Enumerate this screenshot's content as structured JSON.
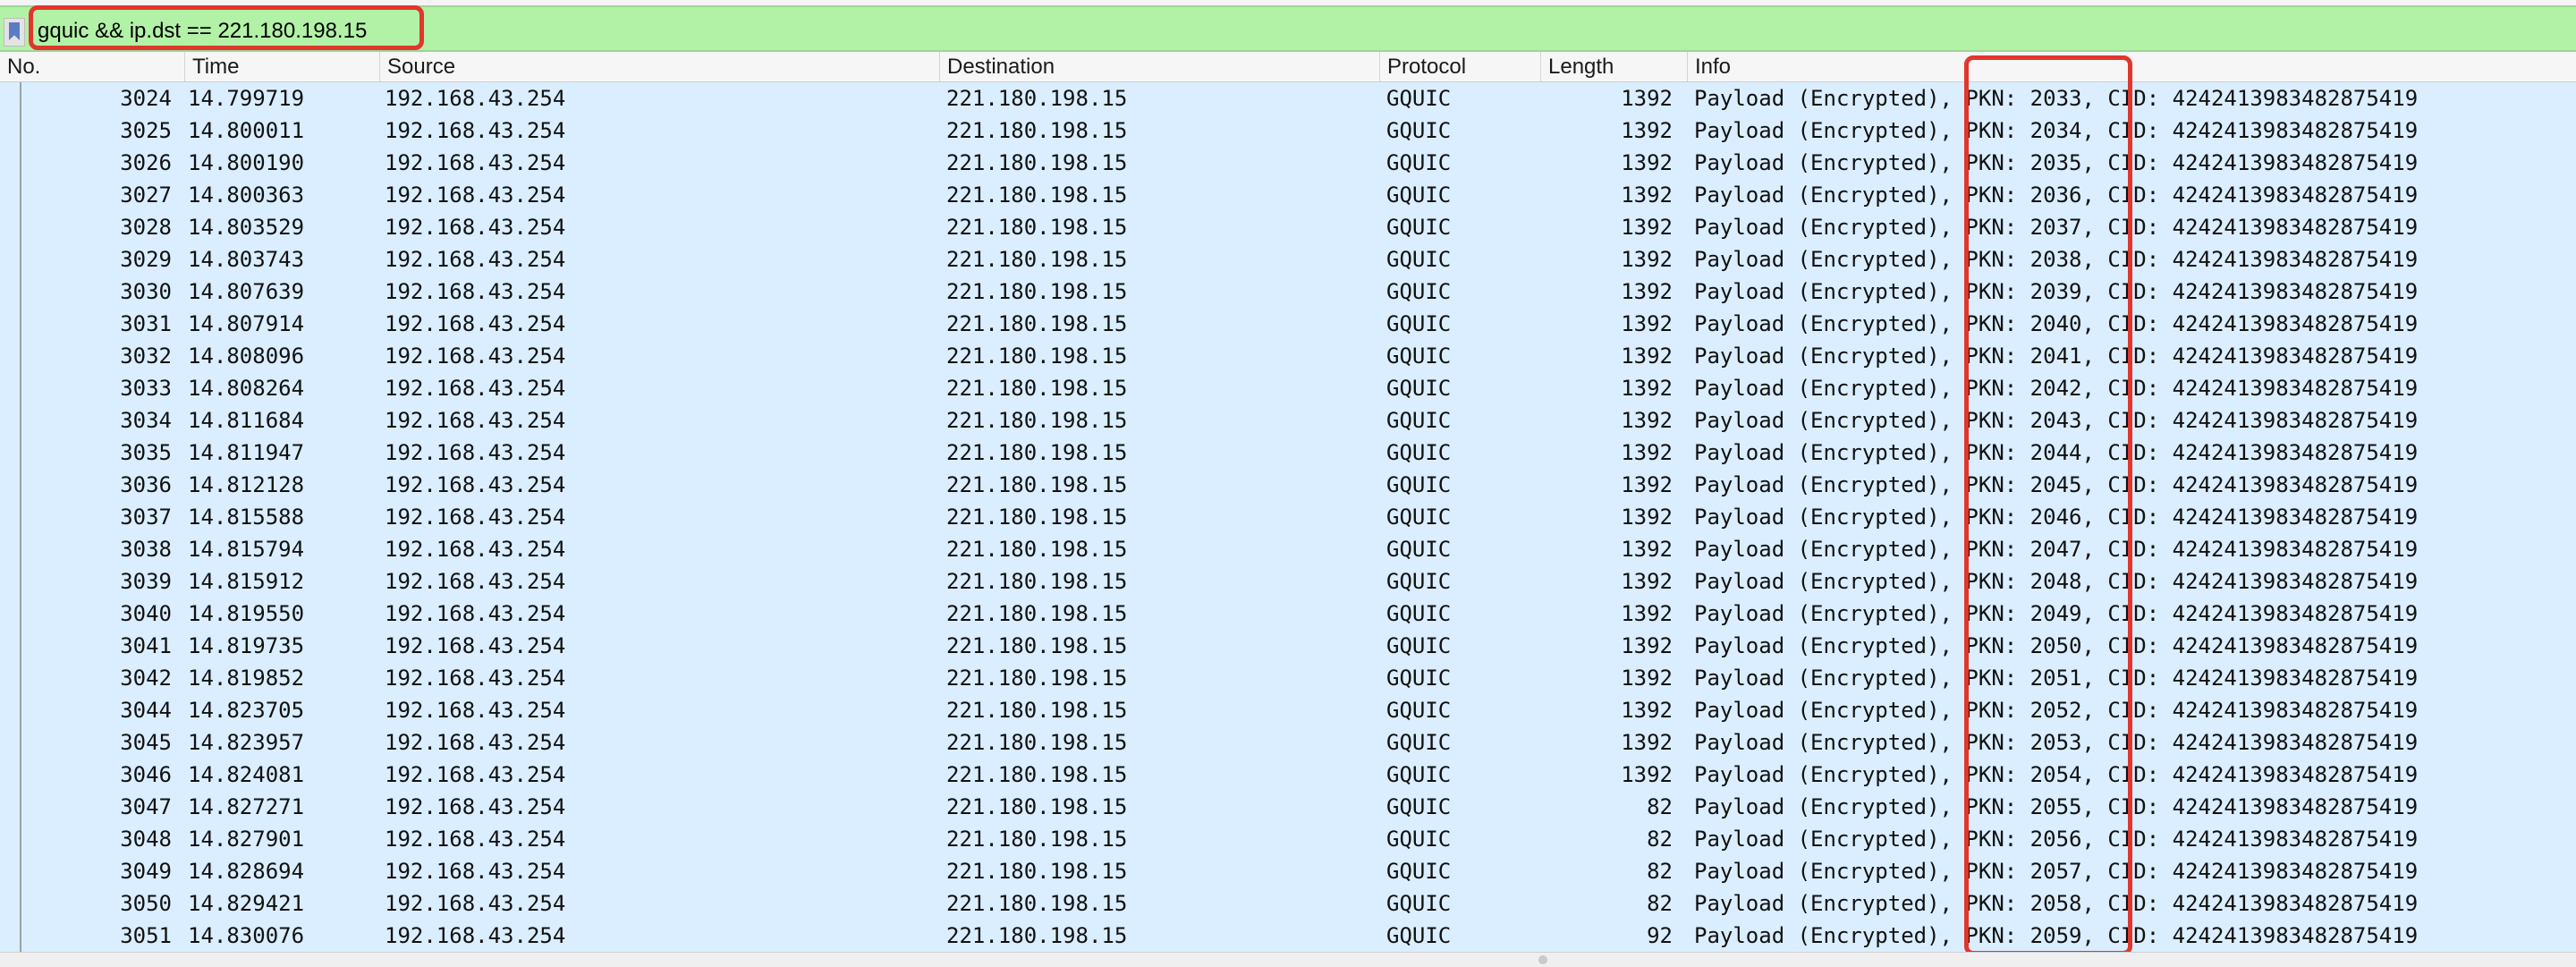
{
  "filter": {
    "value": "gquic && ip.dst == 221.180.198.15"
  },
  "columns": [
    "No.",
    "Time",
    "Source",
    "Destination",
    "Protocol",
    "Length",
    "Info"
  ],
  "packets": [
    {
      "no": "3024",
      "time": "14.799719",
      "src": "192.168.43.254",
      "dst": "221.180.198.15",
      "proto": "GQUIC",
      "len": "1392",
      "info": "Payload (Encrypted), PKN: 2033, CID: 4242413983482875419"
    },
    {
      "no": "3025",
      "time": "14.800011",
      "src": "192.168.43.254",
      "dst": "221.180.198.15",
      "proto": "GQUIC",
      "len": "1392",
      "info": "Payload (Encrypted), PKN: 2034, CID: 4242413983482875419"
    },
    {
      "no": "3026",
      "time": "14.800190",
      "src": "192.168.43.254",
      "dst": "221.180.198.15",
      "proto": "GQUIC",
      "len": "1392",
      "info": "Payload (Encrypted), PKN: 2035, CID: 4242413983482875419"
    },
    {
      "no": "3027",
      "time": "14.800363",
      "src": "192.168.43.254",
      "dst": "221.180.198.15",
      "proto": "GQUIC",
      "len": "1392",
      "info": "Payload (Encrypted), PKN: 2036, CID: 4242413983482875419"
    },
    {
      "no": "3028",
      "time": "14.803529",
      "src": "192.168.43.254",
      "dst": "221.180.198.15",
      "proto": "GQUIC",
      "len": "1392",
      "info": "Payload (Encrypted), PKN: 2037, CID: 4242413983482875419"
    },
    {
      "no": "3029",
      "time": "14.803743",
      "src": "192.168.43.254",
      "dst": "221.180.198.15",
      "proto": "GQUIC",
      "len": "1392",
      "info": "Payload (Encrypted), PKN: 2038, CID: 4242413983482875419"
    },
    {
      "no": "3030",
      "time": "14.807639",
      "src": "192.168.43.254",
      "dst": "221.180.198.15",
      "proto": "GQUIC",
      "len": "1392",
      "info": "Payload (Encrypted), PKN: 2039, CID: 4242413983482875419"
    },
    {
      "no": "3031",
      "time": "14.807914",
      "src": "192.168.43.254",
      "dst": "221.180.198.15",
      "proto": "GQUIC",
      "len": "1392",
      "info": "Payload (Encrypted), PKN: 2040, CID: 4242413983482875419"
    },
    {
      "no": "3032",
      "time": "14.808096",
      "src": "192.168.43.254",
      "dst": "221.180.198.15",
      "proto": "GQUIC",
      "len": "1392",
      "info": "Payload (Encrypted), PKN: 2041, CID: 4242413983482875419"
    },
    {
      "no": "3033",
      "time": "14.808264",
      "src": "192.168.43.254",
      "dst": "221.180.198.15",
      "proto": "GQUIC",
      "len": "1392",
      "info": "Payload (Encrypted), PKN: 2042, CID: 4242413983482875419"
    },
    {
      "no": "3034",
      "time": "14.811684",
      "src": "192.168.43.254",
      "dst": "221.180.198.15",
      "proto": "GQUIC",
      "len": "1392",
      "info": "Payload (Encrypted), PKN: 2043, CID: 4242413983482875419"
    },
    {
      "no": "3035",
      "time": "14.811947",
      "src": "192.168.43.254",
      "dst": "221.180.198.15",
      "proto": "GQUIC",
      "len": "1392",
      "info": "Payload (Encrypted), PKN: 2044, CID: 4242413983482875419"
    },
    {
      "no": "3036",
      "time": "14.812128",
      "src": "192.168.43.254",
      "dst": "221.180.198.15",
      "proto": "GQUIC",
      "len": "1392",
      "info": "Payload (Encrypted), PKN: 2045, CID: 4242413983482875419"
    },
    {
      "no": "3037",
      "time": "14.815588",
      "src": "192.168.43.254",
      "dst": "221.180.198.15",
      "proto": "GQUIC",
      "len": "1392",
      "info": "Payload (Encrypted), PKN: 2046, CID: 4242413983482875419"
    },
    {
      "no": "3038",
      "time": "14.815794",
      "src": "192.168.43.254",
      "dst": "221.180.198.15",
      "proto": "GQUIC",
      "len": "1392",
      "info": "Payload (Encrypted), PKN: 2047, CID: 4242413983482875419"
    },
    {
      "no": "3039",
      "time": "14.815912",
      "src": "192.168.43.254",
      "dst": "221.180.198.15",
      "proto": "GQUIC",
      "len": "1392",
      "info": "Payload (Encrypted), PKN: 2048, CID: 4242413983482875419"
    },
    {
      "no": "3040",
      "time": "14.819550",
      "src": "192.168.43.254",
      "dst": "221.180.198.15",
      "proto": "GQUIC",
      "len": "1392",
      "info": "Payload (Encrypted), PKN: 2049, CID: 4242413983482875419"
    },
    {
      "no": "3041",
      "time": "14.819735",
      "src": "192.168.43.254",
      "dst": "221.180.198.15",
      "proto": "GQUIC",
      "len": "1392",
      "info": "Payload (Encrypted), PKN: 2050, CID: 4242413983482875419"
    },
    {
      "no": "3042",
      "time": "14.819852",
      "src": "192.168.43.254",
      "dst": "221.180.198.15",
      "proto": "GQUIC",
      "len": "1392",
      "info": "Payload (Encrypted), PKN: 2051, CID: 4242413983482875419"
    },
    {
      "no": "3044",
      "time": "14.823705",
      "src": "192.168.43.254",
      "dst": "221.180.198.15",
      "proto": "GQUIC",
      "len": "1392",
      "info": "Payload (Encrypted), PKN: 2052, CID: 4242413983482875419"
    },
    {
      "no": "3045",
      "time": "14.823957",
      "src": "192.168.43.254",
      "dst": "221.180.198.15",
      "proto": "GQUIC",
      "len": "1392",
      "info": "Payload (Encrypted), PKN: 2053, CID: 4242413983482875419"
    },
    {
      "no": "3046",
      "time": "14.824081",
      "src": "192.168.43.254",
      "dst": "221.180.198.15",
      "proto": "GQUIC",
      "len": "1392",
      "info": "Payload (Encrypted), PKN: 2054, CID: 4242413983482875419"
    },
    {
      "no": "3047",
      "time": "14.827271",
      "src": "192.168.43.254",
      "dst": "221.180.198.15",
      "proto": "GQUIC",
      "len": "82",
      "info": "Payload (Encrypted), PKN: 2055, CID: 4242413983482875419"
    },
    {
      "no": "3048",
      "time": "14.827901",
      "src": "192.168.43.254",
      "dst": "221.180.198.15",
      "proto": "GQUIC",
      "len": "82",
      "info": "Payload (Encrypted), PKN: 2056, CID: 4242413983482875419"
    },
    {
      "no": "3049",
      "time": "14.828694",
      "src": "192.168.43.254",
      "dst": "221.180.198.15",
      "proto": "GQUIC",
      "len": "82",
      "info": "Payload (Encrypted), PKN: 2057, CID: 4242413983482875419"
    },
    {
      "no": "3050",
      "time": "14.829421",
      "src": "192.168.43.254",
      "dst": "221.180.198.15",
      "proto": "GQUIC",
      "len": "82",
      "info": "Payload (Encrypted), PKN: 2058, CID: 4242413983482875419"
    },
    {
      "no": "3051",
      "time": "14.830076",
      "src": "192.168.43.254",
      "dst": "221.180.198.15",
      "proto": "GQUIC",
      "len": "92",
      "info": "Payload (Encrypted), PKN: 2059, CID: 4242413983482875419"
    }
  ],
  "colors": {
    "filter_valid": "#b2f2a6",
    "row_background": "#daeeff",
    "annotation": "#e0372d"
  },
  "icons": {
    "bookmark": "bookmark-icon"
  }
}
